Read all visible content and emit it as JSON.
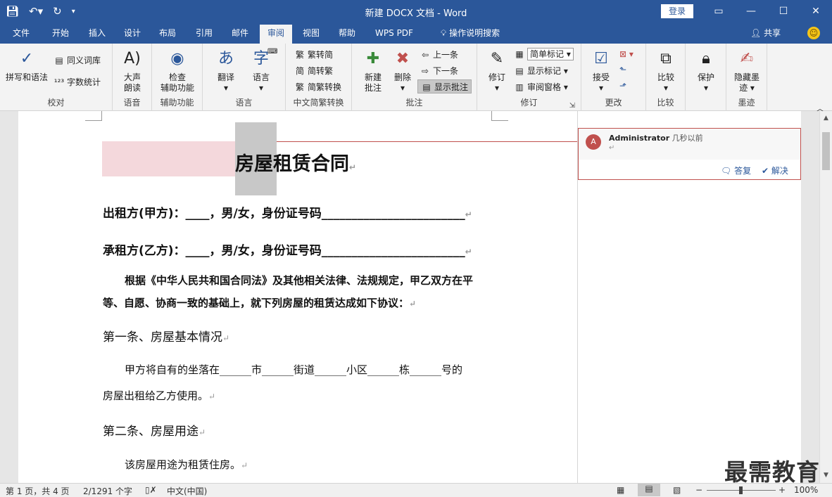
{
  "title_bar": {
    "document_title": "新建 DOCX 文档  -  Word",
    "login": "登录"
  },
  "tabs": [
    "文件",
    "开始",
    "插入",
    "设计",
    "布局",
    "引用",
    "邮件",
    "审阅",
    "视图",
    "帮助",
    "WPS PDF",
    "操作说明搜索"
  ],
  "share": "共享",
  "ribbon": {
    "proofing": {
      "spelling": "拼写和语法",
      "thesaurus": "同义词库",
      "word_count": "字数统计",
      "label": "校对"
    },
    "speech": {
      "read_aloud_1": "大声",
      "read_aloud_2": "朗读",
      "label": "语音"
    },
    "accessibility": {
      "check_1": "检查",
      "check_2": "辅助功能",
      "label": "辅助功能"
    },
    "language": {
      "translate": "翻译",
      "language": "语言",
      "label": "语言"
    },
    "chinese_conversion": {
      "to_traditional": "繁转简",
      "to_simplified": "简转繁",
      "convert": "简繁转换",
      "label": "中文简繁转换"
    },
    "comments": {
      "new_1": "新建",
      "new_2": "批注",
      "delete": "删除",
      "previous": "上一条",
      "next": "下一条",
      "show_comments": "显示批注",
      "label": "批注"
    },
    "tracking": {
      "track_changes": "修订",
      "markup_value": "简单标记",
      "show_markup": "显示标记",
      "review_pane": "审阅窗格",
      "label": "修订"
    },
    "changes": {
      "accept": "接受",
      "label": "更改"
    },
    "compare": {
      "compare": "比较",
      "label": "比较"
    },
    "protect": {
      "protect": "保护"
    },
    "ink": {
      "hide_1": "隐藏墨",
      "hide_2": "迹",
      "label": "墨迹"
    }
  },
  "document": {
    "title": "房屋租赁合同",
    "line1": "出租方(甲方)：____，男/女，身份证号码________________________",
    "line2": "承租方(乙方)：____，男/女，身份证号码________________________",
    "para1a": "根据《中华人民共和国合同法》及其他相关法律、法规规定，甲乙双方在平",
    "para1b": "等、自愿、协商一致的基础上，就下列房屋的租赁达成如下协议：",
    "section1": "第一条、房屋基本情况",
    "para2a": "甲方将自有的坐落在______市______街道______小区______栋______号的",
    "para2b": "房屋出租给乙方使用。",
    "section2": "第二条、房屋用途",
    "para3": "该房屋用途为租赁住房。",
    "para_mark": "↵"
  },
  "comment": {
    "avatar": "A",
    "author": "Administrator",
    "time": "几秒以前",
    "body": "↵",
    "reply": "答复",
    "resolve": "解决"
  },
  "status": {
    "page": "第 1 页，共 4 页",
    "words": "2/1291 个字",
    "language": "中文(中国)",
    "zoom": "100%",
    "zoom_level": 100
  },
  "watermark": "最需教育",
  "colors": {
    "word_blue": "#2b579a",
    "comment_red": "#c0504d"
  }
}
